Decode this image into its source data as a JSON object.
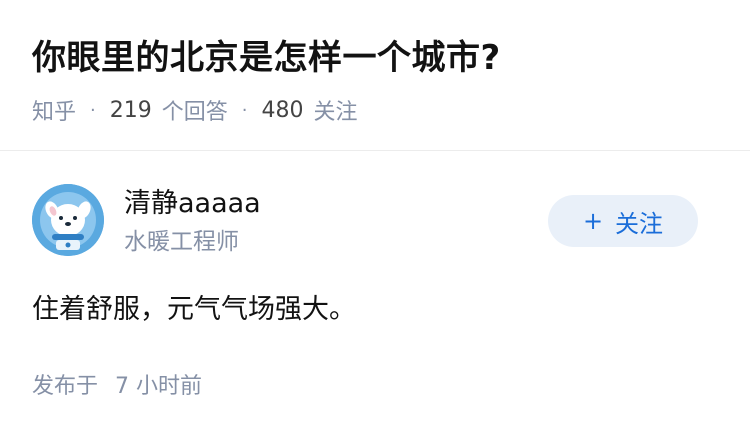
{
  "question": {
    "title": "你眼里的北京是怎样一个城市?",
    "site": "知乎",
    "separator": "·",
    "answer_count": "219",
    "answer_label": "个回答",
    "follower_count": "480",
    "follower_label": "关注"
  },
  "answer": {
    "author_name": "清静aaaaa",
    "author_bio": "水暖工程师",
    "follow_icon": "plus-icon",
    "follow_symbol": "+",
    "follow_label": "关注",
    "content": "住着舒服，元气气场强大。",
    "publish_prefix": "发布于",
    "publish_time": "7 小时前"
  },
  "colors": {
    "accent": "#1a6dd9",
    "follow_bg": "#e9f0f9",
    "secondary_text": "#8590a6",
    "primary_text": "#121212",
    "avatar_bg": "#5aa9e0"
  }
}
